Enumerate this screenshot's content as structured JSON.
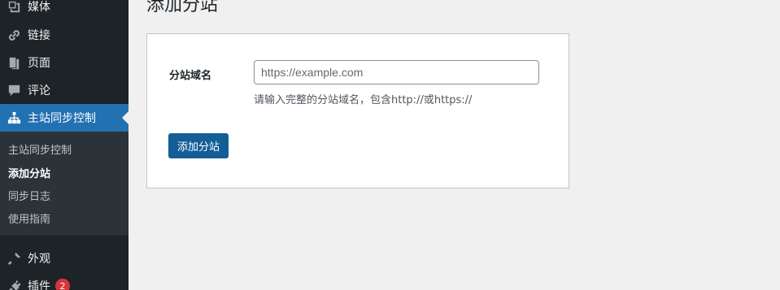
{
  "sidebar": {
    "items": [
      {
        "label": "媒体",
        "icon": "media-icon"
      },
      {
        "label": "链接",
        "icon": "link-icon"
      },
      {
        "label": "页面",
        "icon": "page-icon"
      },
      {
        "label": "评论",
        "icon": "comment-icon"
      },
      {
        "label": "主站同步控制",
        "icon": "sitemap-icon",
        "active": true
      },
      {
        "label": "外观",
        "icon": "appearance-icon"
      },
      {
        "label": "插件",
        "icon": "plugin-icon",
        "badge": "2"
      }
    ],
    "submenu": [
      {
        "label": "主站同步控制"
      },
      {
        "label": "添加分站",
        "current": true
      },
      {
        "label": "同步日志"
      },
      {
        "label": "使用指南"
      }
    ]
  },
  "main": {
    "title": "添加分站",
    "form": {
      "domain_label": "分站域名",
      "domain_placeholder": "https://example.com",
      "domain_value": "",
      "domain_description": "请输入完整的分站域名，包含http://或https://",
      "submit_label": "添加分站"
    }
  },
  "colors": {
    "sidebar_bg": "#1d2327",
    "submenu_bg": "#2c3338",
    "accent": "#2271b1",
    "button_bg": "#135e96",
    "badge": "#d63638",
    "page_bg": "#f0f0f1"
  }
}
